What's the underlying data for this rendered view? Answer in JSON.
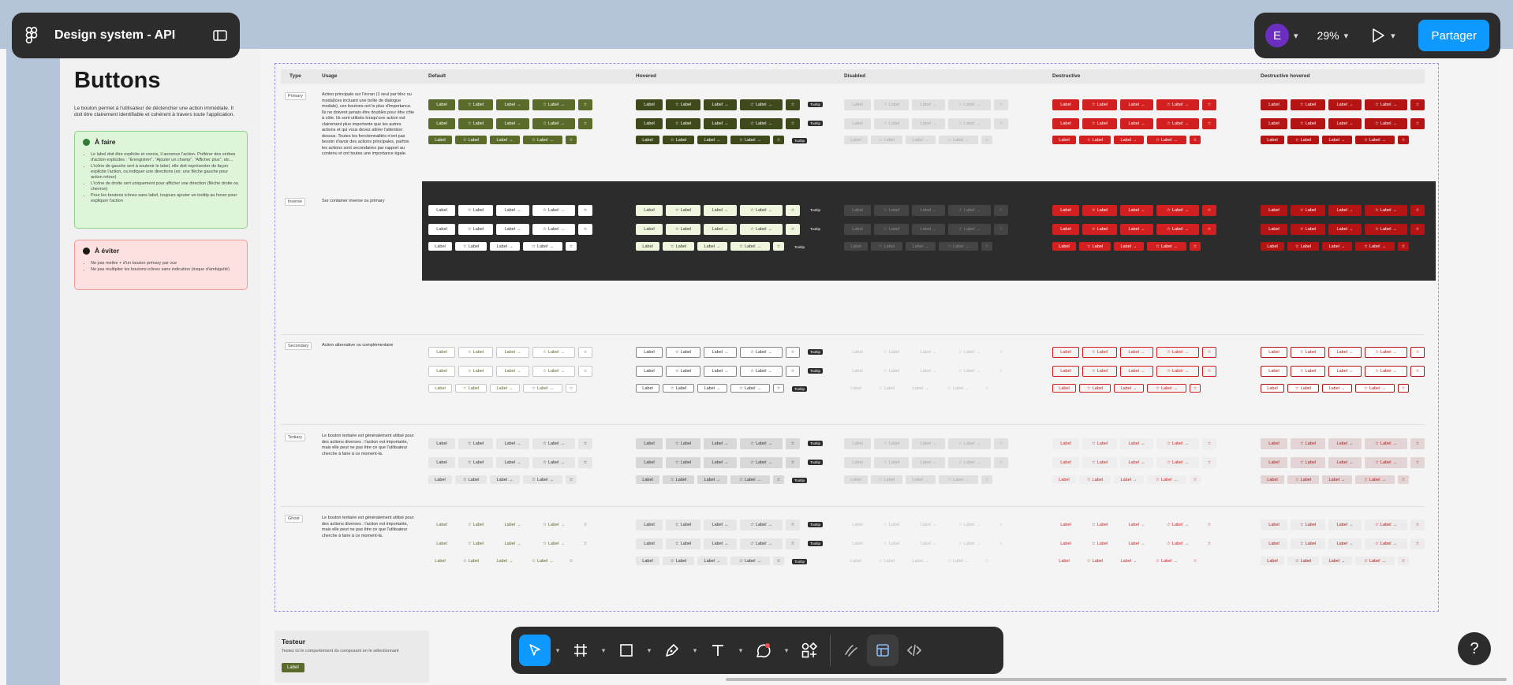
{
  "app": {
    "file_title": "Design system - API",
    "user_initial": "E",
    "zoom": "29%",
    "share_label": "Partager",
    "help_label": "?"
  },
  "doc": {
    "heading": "Buttons",
    "intro": "Le bouton permet à l'utilisateur de déclencher une action immédiate. Il doit être clairement identifiable et cohérent à travers toute l'application.",
    "do_title": "À faire",
    "do_items": [
      "Le label doit être explicite et concis, il annonce l'action. Préférer des verbes d'action explicites : \"Enregistrer\", \"Ajouter un champ\", \"Afficher plus\", etc...",
      "L'icône de gauche sert à soutenir le label, elle doit représenter de façon explicite l'action, ou indiquer une directions (ex: une flèche gauche pour action retour)",
      "L'icône de droite sert uniquement pour afficher une direction (flèche droite ou chevron)",
      "Pour les boutons icônes sans label, toujours ajouter un tooltip au hover pour expliquer l'action"
    ],
    "dont_title": "À éviter",
    "dont_items": [
      "Ne pas mettre + d'un bouton primary par vue",
      "Ne pas multiplier les boutons icônes sans indication (risque d'ambiguïté)"
    ]
  },
  "table": {
    "headers": [
      "Type",
      "Usage",
      "Default",
      "Hovered",
      "Disabled",
      "Destructive",
      "Destructive hovered"
    ],
    "rows": [
      {
        "type": "Primary",
        "usage": "Action principale sur l'écran (1 seul par bloc ou modal)ces incluant une boîte de dialogue modale), ces boutons ont le plus d'importance. Ils ne doivent jamais être doublés pour être côte à côte. Ils sont utilisés lorsqu'une action est clairement plus importante que les autres actions et qui vous devez attirer l'attention dessus. Toutes les fonctionnalités n'ont pas besoin d'avoir des actions principales, parfois les actions sont secondaires par rapport au contenu et ont toutes une importance égale."
      },
      {
        "type": "Inverse",
        "usage": "Sur container inverse ou primary"
      },
      {
        "type": "Secondary",
        "usage": "Action alternative ou complémentaire"
      },
      {
        "type": "Tertiary",
        "usage": "Le bouton tertiaire est généralement utilisé pour des actions diverses : l'action est importante, mais elle peut ne pas être ce que l'utilisateur cherche à faire à ce moment-là."
      },
      {
        "type": "Ghost",
        "usage": "Le bouton tertiaire est généralement utilisé pour des actions diverses : l'action est importante, mais elle peut ne pas être ce que l'utilisateur cherche à faire à ce moment-là."
      }
    ],
    "button_label": "Label",
    "tooltip_label": "Tooltip"
  },
  "tester": {
    "title": "Testeur",
    "desc": "Testez ici le comportement du composant en le sélectionnant",
    "button": "Label"
  },
  "colors": {
    "accent": "#0d99ff",
    "primary": "#5a6b2a",
    "primary_hover": "#3f4a1c",
    "destructive": "#d21f1f",
    "destructive_hover": "#b51414",
    "dark": "#2c2c2c"
  }
}
